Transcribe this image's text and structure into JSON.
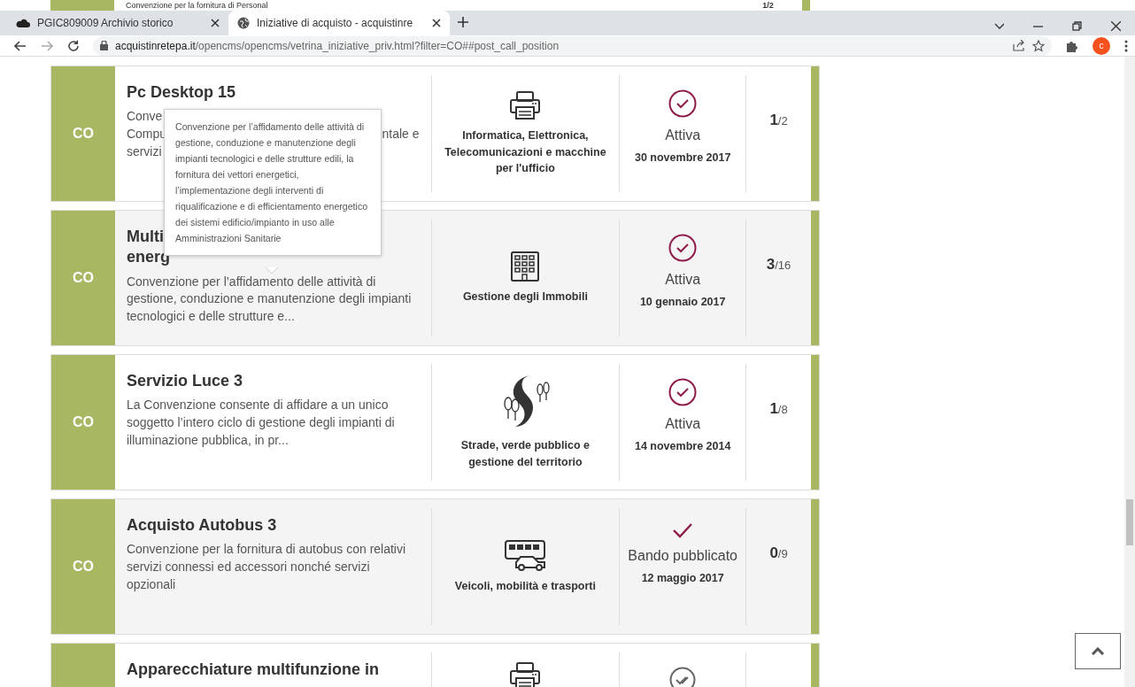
{
  "browser": {
    "tabs": [
      {
        "title": "PGIC809009 Archivio storico",
        "selected": false
      },
      {
        "title": "Iniziative di acquisto - acquistinre",
        "selected": true
      }
    ],
    "url_domain": "acquistinretepa.it",
    "url_path": "/opencms/opencms/vetrina_iniziative_priv.html?filter=CO##post_call_position",
    "profile_initial": "c"
  },
  "partial_row": {
    "text": "Convenzione per la fornitura di Personal",
    "count": "1/2"
  },
  "cards": [
    {
      "badge": "CO",
      "title_lines": [
        {
          "start": "Pc Desktop 15"
        }
      ],
      "description_lines": [
        {
          "start": "Conve"
        },
        {
          "start": "Compu",
          "end": "ntale e"
        },
        {
          "start": "servizi"
        }
      ],
      "category": "Informatica, Elettronica, Telecomunicazioni e macchine per l'ufficio",
      "kind": "active",
      "status": "Attiva",
      "date": "30 novembre 2017",
      "count_done": "1",
      "count_total": "/2"
    },
    {
      "badge": "CO",
      "title_lines": [
        {
          "start": "Multi"
        },
        {
          "start": "energ"
        }
      ],
      "description": "Convenzione per l’affidamento delle attività di gestione, conduzione e manutenzione degli impianti tecnologici e delle strutture e...",
      "category": "Gestione degli Immobili",
      "kind": "active",
      "status": "Attiva",
      "date": "10 gennaio 2017",
      "count_done": "3",
      "count_total": "/16"
    },
    {
      "badge": "CO",
      "title_lines": [
        {
          "start": "Servizio Luce 3"
        }
      ],
      "description": "La Convenzione consente di affidare a un unico soggetto l’intero ciclo di gestione degli impianti di illuminazione pubblica, in pr...",
      "category": "Strade, verde pubblico e gestione del territorio",
      "kind": "active",
      "status": "Attiva",
      "date": "14 novembre 2014",
      "count_done": "1",
      "count_total": "/8"
    },
    {
      "badge": "CO",
      "title_lines": [
        {
          "start": "Acquisto Autobus 3"
        }
      ],
      "description": "Convenzione per la fornitura di autobus con relativi servizi connessi ed accessori nonché servizi opzionali",
      "category": "Veicoli, mobilità e trasporti",
      "kind": "published",
      "status": "Bando pubblicato",
      "date": "12 maggio 2017",
      "count_done": "0",
      "count_total": "/9"
    },
    {
      "title_lines": [
        {
          "start": "Apparecchiature multifunzione in"
        }
      ],
      "kind": "closed"
    }
  ],
  "tooltip": {
    "text": "Convenzione per l’affidamento delle attività di gestione, conduzione e manutenzione degli impianti tecnologici e delle strutture edili, la fornitura dei vettori energetici, l’implementazione degli interventi di riqualificazione e di efficientamento energetico dei sistemi edificio/impianto in uso alle Amministrazioni Sanitarie"
  }
}
